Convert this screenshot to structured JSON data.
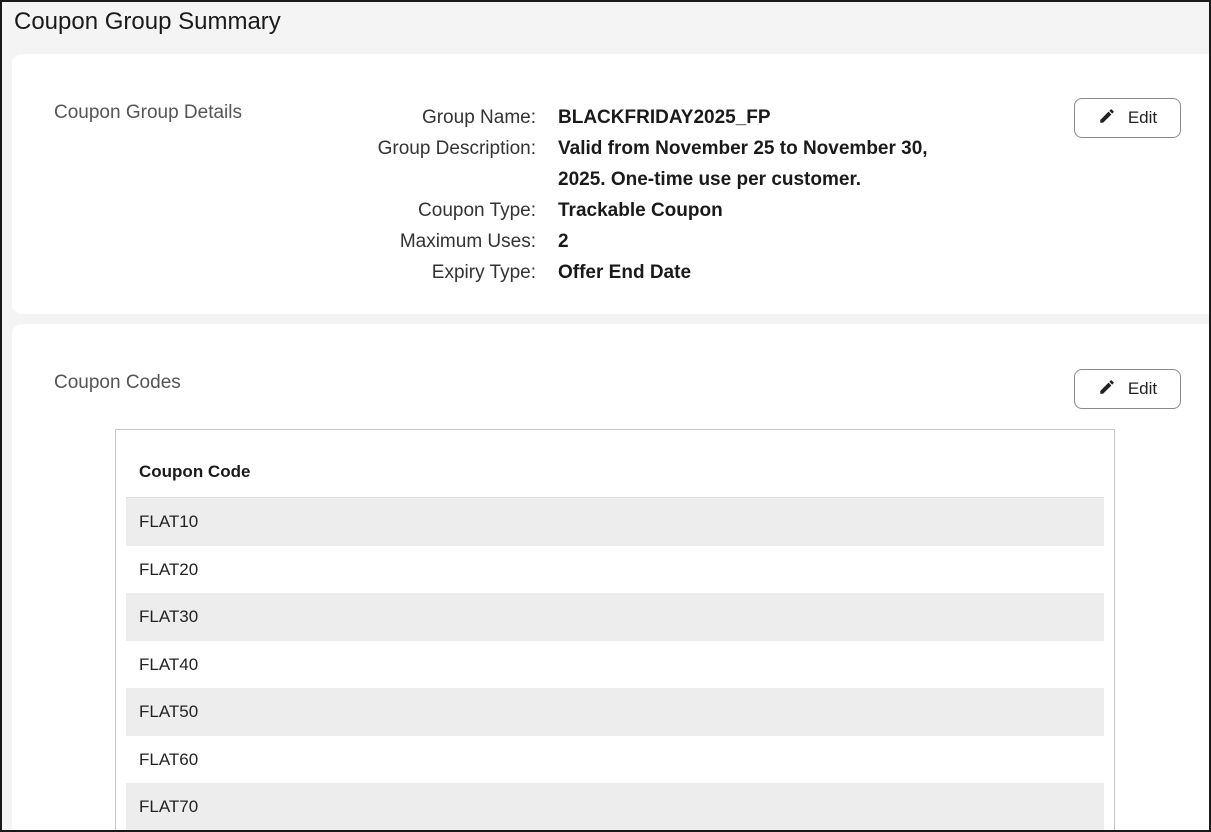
{
  "page": {
    "title": "Coupon Group Summary"
  },
  "details": {
    "section_label": "Coupon Group Details",
    "edit_label": "Edit",
    "fields": [
      {
        "label": "Group Name:",
        "value": "BLACKFRIDAY2025_FP"
      },
      {
        "label": "Group Description:",
        "value": "Valid from November 25 to November 30, 2025. One-time use per customer."
      },
      {
        "label": "Coupon Type:",
        "value": "Trackable Coupon"
      },
      {
        "label": "Maximum Uses:",
        "value": "2"
      },
      {
        "label": "Expiry Type:",
        "value": "Offer End Date"
      }
    ]
  },
  "codes": {
    "section_label": "Coupon Codes",
    "edit_label": "Edit",
    "column_header": "Coupon Code",
    "rows": [
      "FLAT10",
      "FLAT20",
      "FLAT30",
      "FLAT40",
      "FLAT50",
      "FLAT60",
      "FLAT70"
    ]
  },
  "icons": {
    "edit": "pencil-icon"
  }
}
